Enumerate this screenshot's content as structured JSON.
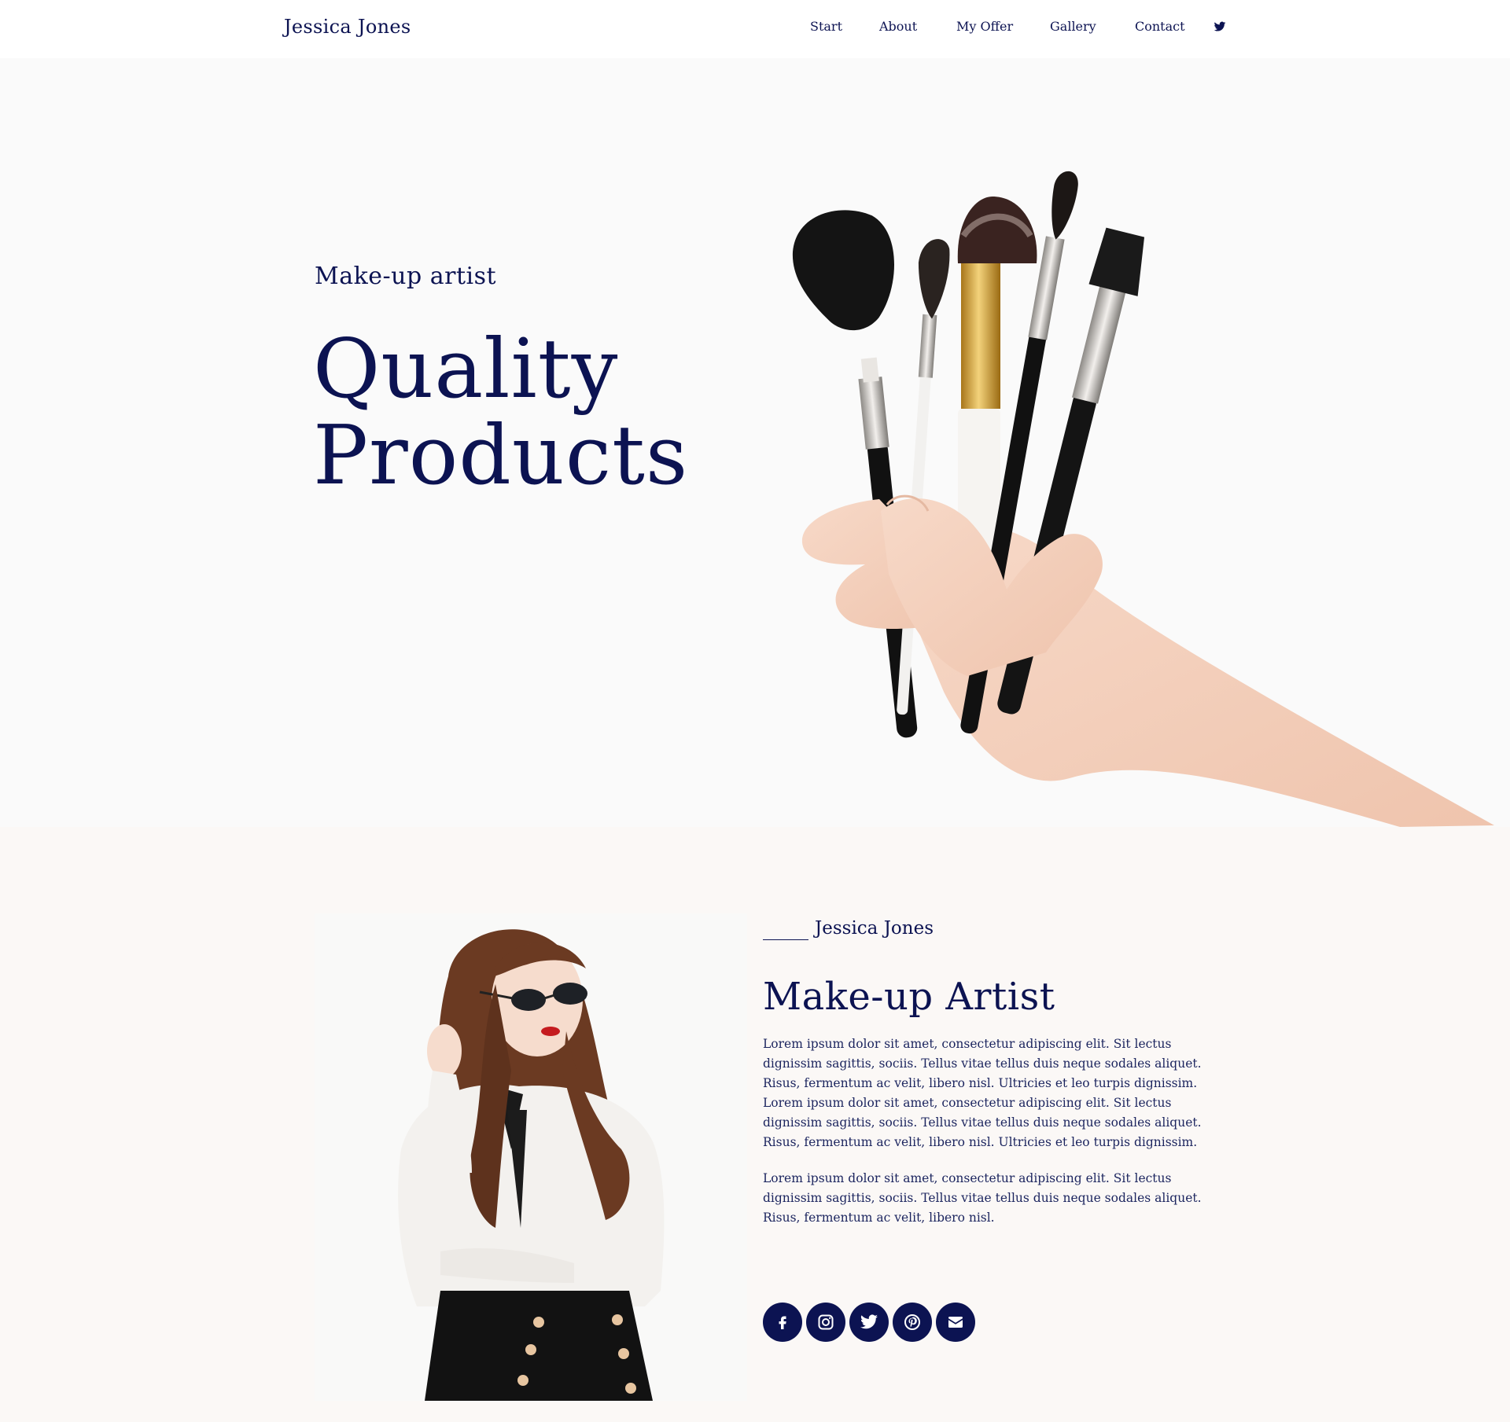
{
  "header": {
    "brand": "Jessica Jones",
    "nav": [
      {
        "label": "Start"
      },
      {
        "label": "About"
      },
      {
        "label": "My Offer"
      },
      {
        "label": "Gallery"
      },
      {
        "label": "Contact"
      }
    ],
    "social_icon": "twitter-icon"
  },
  "hero": {
    "eyebrow": "Make-up artist",
    "title_line1": "Quality",
    "title_line2": "Products"
  },
  "about": {
    "kicker": "Jessica Jones",
    "title": "Make-up Artist",
    "paragraphs": [
      "Lorem ipsum dolor sit amet, consectetur adipiscing elit. Sit lectus dignissim sagittis, sociis. Tellus vitae tellus duis neque sodales aliquet. Risus, fermentum ac velit, libero nisl. Ultricies et leo turpis dignissim. Lorem ipsum dolor sit amet, consectetur adipiscing elit. Sit lectus dignissim sagittis, sociis. Tellus vitae tellus duis neque sodales aliquet. Risus, fermentum ac velit, libero nisl. Ultricies et leo turpis dignissim.",
      "Lorem ipsum dolor sit amet, consectetur adipiscing elit. Sit lectus dignissim sagittis, sociis. Tellus vitae tellus duis neque sodales aliquet. Risus, fermentum ac velit, libero nisl."
    ],
    "social_icons": [
      "facebook-icon",
      "instagram-icon",
      "twitter-icon",
      "pinterest-icon",
      "email-icon"
    ]
  },
  "colors": {
    "navy": "#0c1352",
    "hero_bg": "#fafafa",
    "about_bg": "#fbf8f6"
  }
}
